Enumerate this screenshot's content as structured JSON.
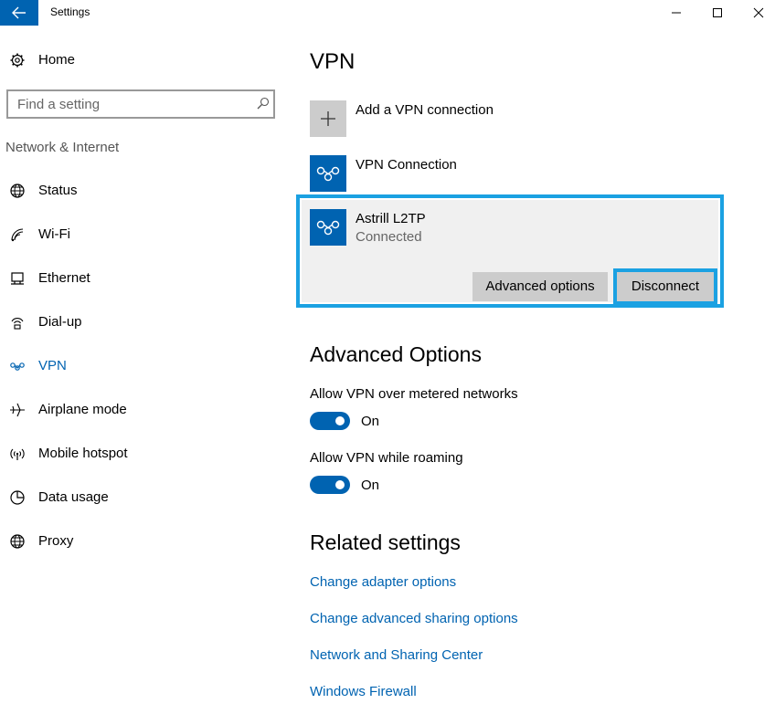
{
  "window": {
    "title": "Settings",
    "back_icon": "back-arrow-icon",
    "controls": [
      "minimize-icon",
      "maximize-icon",
      "close-icon"
    ]
  },
  "sidebar": {
    "home_label": "Home",
    "search_placeholder": "Find a setting",
    "section_title": "Network & Internet",
    "items": [
      {
        "label": "Status",
        "icon": "globe-icon"
      },
      {
        "label": "Wi-Fi",
        "icon": "wifi-icon"
      },
      {
        "label": "Ethernet",
        "icon": "ethernet-icon"
      },
      {
        "label": "Dial-up",
        "icon": "dialup-icon"
      },
      {
        "label": "VPN",
        "icon": "vpn-icon",
        "active": true
      },
      {
        "label": "Airplane mode",
        "icon": "airplane-icon"
      },
      {
        "label": "Mobile hotspot",
        "icon": "hotspot-icon"
      },
      {
        "label": "Data usage",
        "icon": "data-usage-icon"
      },
      {
        "label": "Proxy",
        "icon": "globe-icon"
      }
    ]
  },
  "main": {
    "title": "VPN",
    "add_vpn_label": "Add a VPN connection",
    "connections": [
      {
        "name": "VPN Connection"
      },
      {
        "name": "Astrill L2TP",
        "status": "Connected"
      }
    ],
    "buttons": {
      "advanced_options": "Advanced options",
      "disconnect": "Disconnect"
    },
    "advanced_title": "Advanced Options",
    "metered_label": "Allow VPN over metered networks",
    "metered_state": "On",
    "roaming_label": "Allow VPN while roaming",
    "roaming_state": "On",
    "related_title": "Related settings",
    "links": [
      "Change adapter options",
      "Change advanced sharing options",
      "Network and Sharing Center",
      "Windows Firewall"
    ]
  },
  "colors": {
    "accent": "#0063b1",
    "highlight": "#1ba1e2",
    "card_bg": "#f0f0f0",
    "button_bg": "#cccccc"
  }
}
